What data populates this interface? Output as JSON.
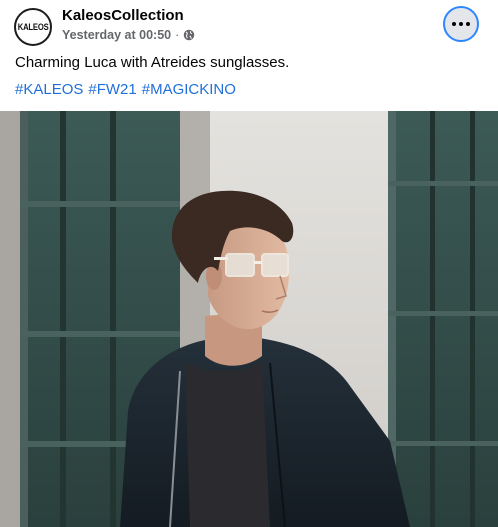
{
  "post": {
    "author_name": "KaleosCollection",
    "avatar_text": "KALEOS",
    "timestamp": "Yesterday at 00:50",
    "separator": "·",
    "audience_icon": "globe-icon",
    "more_icon": "more-options-icon",
    "caption": "Charming Luca with Atreides sunglasses.",
    "hashtags": [
      "#KALEOS",
      "#FW21",
      "#MAGICKINO"
    ],
    "photo_icon": "post-photo"
  },
  "colors": {
    "link": "#216fdb",
    "secondary_text": "#65676b",
    "focus_ring": "#2d88ff"
  }
}
